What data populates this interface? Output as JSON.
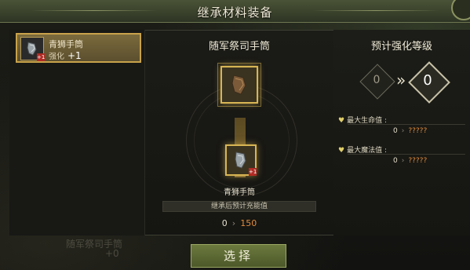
{
  "window": {
    "title": "继承材料装备"
  },
  "left_list": {
    "items": [
      {
        "name": "青狮手筒",
        "enhance_label": "强化",
        "enhance_value": "+1",
        "badge": "+1"
      }
    ],
    "ghost_item": {
      "name": "随军祭司手筒",
      "enhance_value": "+0"
    }
  },
  "center": {
    "title": "随军祭司手筒",
    "material_name": "青狮手筒",
    "material_badge": "+1",
    "energy_label": "继承后预计充能值",
    "energy_from": "0",
    "energy_to": "150"
  },
  "right": {
    "title": "预计强化等级",
    "level_from": "0",
    "level_to": "0",
    "stats": [
      {
        "label": "最大生命值 :",
        "from": "0",
        "to": "?????"
      },
      {
        "label": "最大魔法值 :",
        "from": "0",
        "to": "?????"
      }
    ]
  },
  "actions": {
    "select_label": "选择"
  },
  "colors": {
    "accent_gold": "#d8b554",
    "value_orange": "#e08b3a",
    "button_green": "#5d6b33"
  }
}
